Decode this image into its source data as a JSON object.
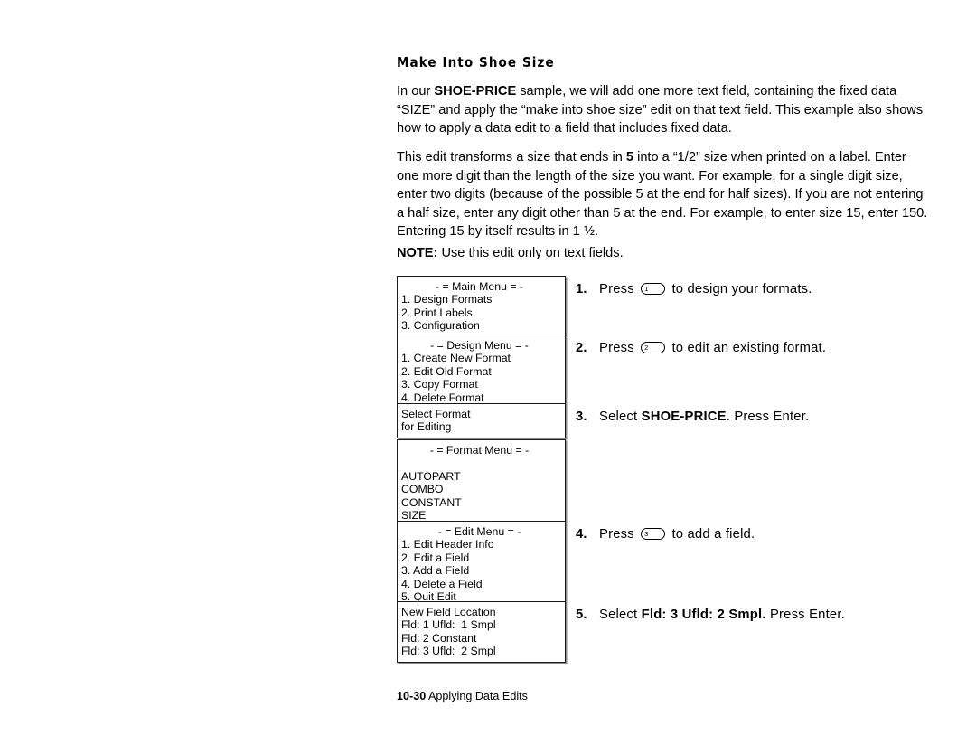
{
  "document": {
    "heading": "Make Into Shoe Size",
    "paragraphs": {
      "p1_a": "In our ",
      "p1_b": "SHOE-PRICE",
      "p1_c": " sample, we will add one more text field, containing the fixed data “SIZE” and apply the “make into shoe size” edit on that text field.  This example also shows how to apply a data edit to a field that includes fixed data.",
      "p2_a": "This edit transforms a size that ends in ",
      "p2_b": "5",
      "p2_c": " into a “1/2” size when printed on a label.  Enter one more digit than the length of the size you want.  For example, for a single digit size, enter two digits (because of the possible 5 at the end for half sizes).  If you are not entering a half size, enter any digit other than 5 at the end.  For example, to enter size 15, enter 150.  Entering 15 by itself results in 1 ½.",
      "note_label": "NOTE:",
      "note_text": "  Use this edit only on text fields."
    },
    "footer": {
      "page_number": "10-30",
      "title": " Applying Data Edits"
    }
  },
  "lcd_screens": [
    {
      "name": "main-menu",
      "title": "- = Main Menu = -",
      "lines": [
        "1. Design Formats",
        "2. Print Labels",
        "3. Configuration"
      ]
    },
    {
      "name": "design-menu",
      "title": "- = Design Menu = -",
      "lines": [
        "1. Create New Format",
        "2. Edit Old Format",
        "3. Copy Format",
        "4. Delete Format"
      ]
    },
    {
      "name": "select-format",
      "title": "",
      "lines": [
        "Select Format",
        "for Editing"
      ]
    },
    {
      "name": "format-menu",
      "title": "- = Format Menu = -",
      "lines": [
        "",
        "AUTOPART",
        "COMBO",
        "CONSTANT",
        "SIZE"
      ]
    },
    {
      "name": "edit-menu",
      "title": "- = Edit Menu = -",
      "lines": [
        "1. Edit Header Info",
        "2. Edit a Field",
        "3. Add a Field",
        "4. Delete a Field",
        "5. Quit Edit"
      ]
    },
    {
      "name": "new-field-location",
      "title": "",
      "lines": [
        "New Field Location",
        "Fld: 1 Ufld:  1 Smpl",
        "Fld: 2 Constant",
        "Fld: 3 Ufld:  2 Smpl"
      ]
    }
  ],
  "steps": [
    {
      "number": "1.",
      "pre": "Press ",
      "key": "1",
      "post": " to design your formats."
    },
    {
      "number": "2.",
      "pre": "Press ",
      "key": "2",
      "post": " to edit an existing format."
    },
    {
      "number": "3.",
      "pre": "Select ",
      "bold": "SHOE-PRICE",
      "post": ".  Press Enter."
    },
    {
      "number": "4.",
      "pre": "Press ",
      "key": "3",
      "post": " to add a field."
    },
    {
      "number": "5.",
      "pre": "Select ",
      "bold": "Fld:  3 Ufld:  2 Smpl.",
      "post": " Press Enter."
    }
  ]
}
